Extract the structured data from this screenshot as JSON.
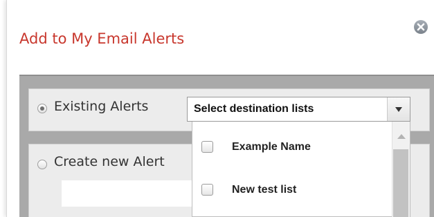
{
  "dialog": {
    "title": "Add to My Email Alerts",
    "close_icon": "close-circle-icon"
  },
  "existing_alerts": {
    "label": "Existing Alerts",
    "selected": true
  },
  "create_new_alert": {
    "label": "Create new Alert",
    "selected": false,
    "name_value": ""
  },
  "destination_select": {
    "placeholder": "Select destination lists",
    "arrow_icon": "triangle-down-icon",
    "options": [
      {
        "label": "Example Name",
        "checked": false
      },
      {
        "label": "New test list",
        "checked": false
      }
    ]
  },
  "colors": {
    "title": "#c8372d",
    "panel": "#a9a9a9",
    "row_background": "#ececec"
  }
}
